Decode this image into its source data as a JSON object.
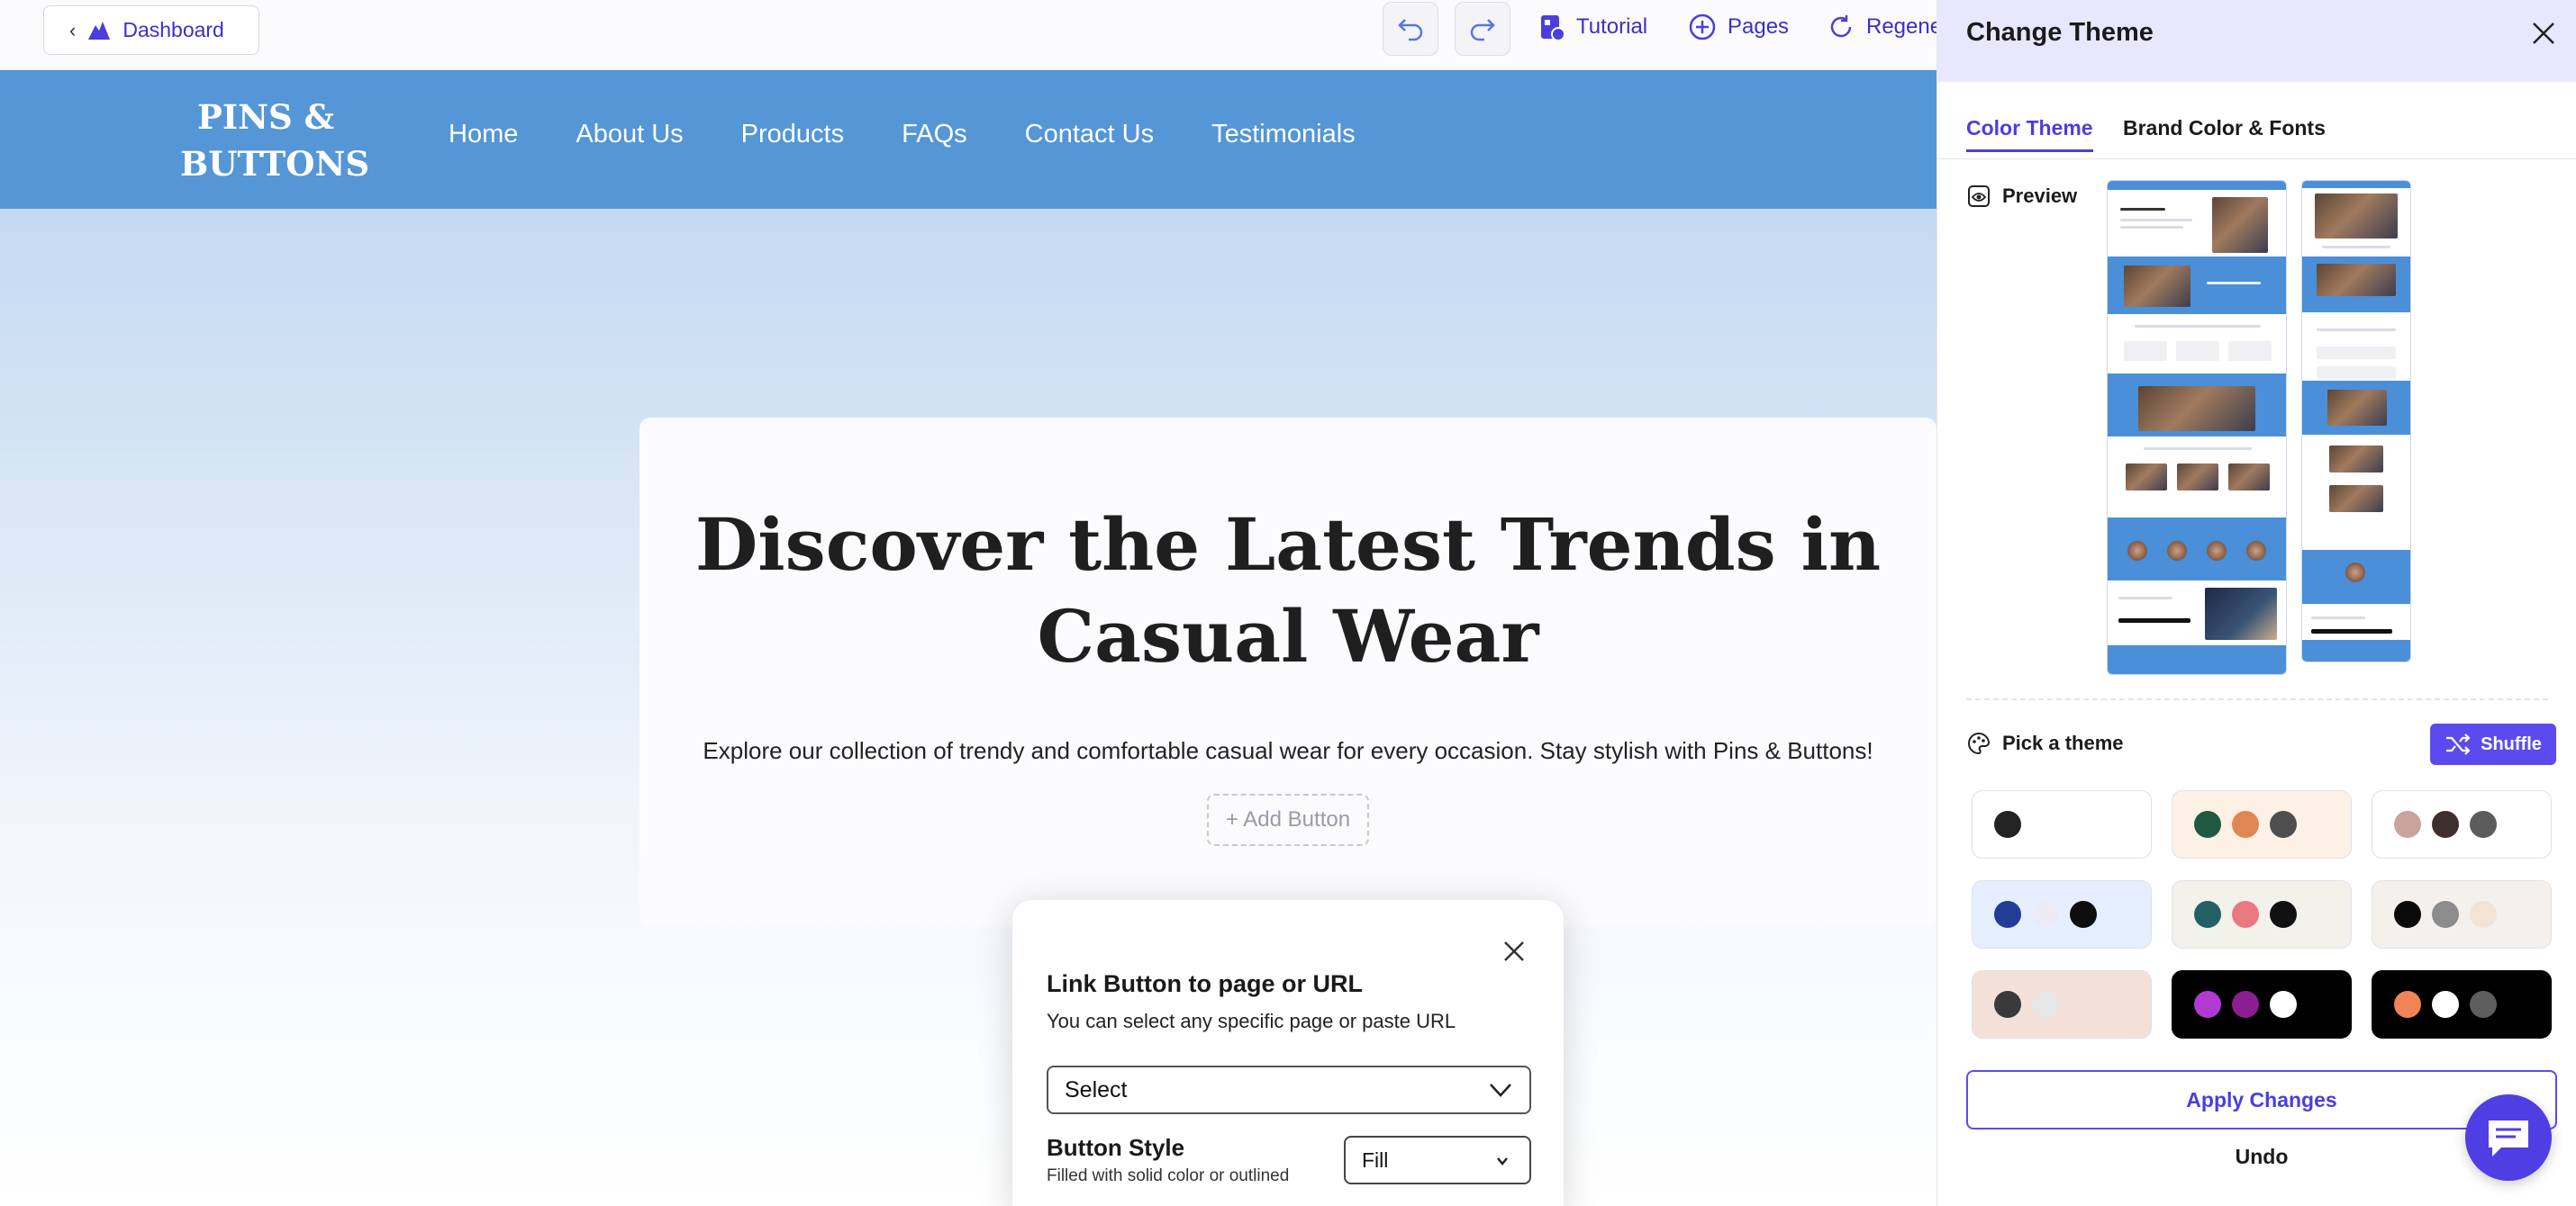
{
  "toolbar": {
    "dashboard_label": "Dashboard",
    "tutorial_label": "Tutorial",
    "pages_label": "Pages",
    "regenerate_label": "Regene"
  },
  "site": {
    "logo_line1": "PINS &",
    "logo_line2": "BUTTONS",
    "nav": [
      "Home",
      "About Us",
      "Products",
      "FAQs",
      "Contact Us",
      "Testimonials"
    ],
    "hero_title_line1": "Discover the Latest Trends in",
    "hero_title_line2": "Casual Wear",
    "hero_subtitle": "Explore our collection of trendy and comfortable casual wear for every occasion. Stay stylish with Pins & Buttons!",
    "add_button_label": "+ Add Button"
  },
  "link_popup": {
    "title": "Link Button to page or URL",
    "subtitle": "You can select any specific page or paste URL",
    "select_value": "Select",
    "button_style_title": "Button Style",
    "button_style_subtitle": "Filled with solid color or outlined",
    "button_style_value": "Fill"
  },
  "panel": {
    "title": "Change Theme",
    "tabs": [
      "Color Theme",
      "Brand Color & Fonts"
    ],
    "active_tab": "Color Theme",
    "preview_label": "Preview",
    "pick_label": "Pick a theme",
    "shuffle_label": "Shuffle",
    "apply_label": "Apply Changes",
    "undo_label": "Undo",
    "themes": [
      {
        "bg": "#ffffff",
        "colors": [
          "#232323"
        ]
      },
      {
        "bg": "#fdf1e6",
        "colors": [
          "#1f5a40",
          "#e08654",
          "#4e4e4e"
        ]
      },
      {
        "bg": "#ffffff",
        "colors": [
          "#c9a39c",
          "#3e2f2d",
          "#5c5c5c"
        ]
      },
      {
        "bg": "#e6efff",
        "colors": [
          "#213d98",
          "#ecebf5",
          "#0e0e0e"
        ]
      },
      {
        "bg": "#f2f1ea",
        "colors": [
          "#235f67",
          "#e87a7f",
          "#111111"
        ]
      },
      {
        "bg": "#f4f0eb",
        "colors": [
          "#0a0a0a",
          "#8c8c8c",
          "#f1e4d5"
        ]
      },
      {
        "bg": "#f3e1d9",
        "colors": [
          "#3a3a3a",
          "#e6e6e6"
        ]
      },
      {
        "bg": "#000000",
        "colors": [
          "#b13ad3",
          "#8b1e92",
          "#ffffff"
        ]
      },
      {
        "bg": "#000000",
        "colors": [
          "#ef8459",
          "#ffffff",
          "#5e5e5e"
        ]
      }
    ]
  },
  "colors": {
    "accent": "#4a3ee0",
    "site_header": "#5496d6",
    "panel_header": "#e9e7fd"
  }
}
